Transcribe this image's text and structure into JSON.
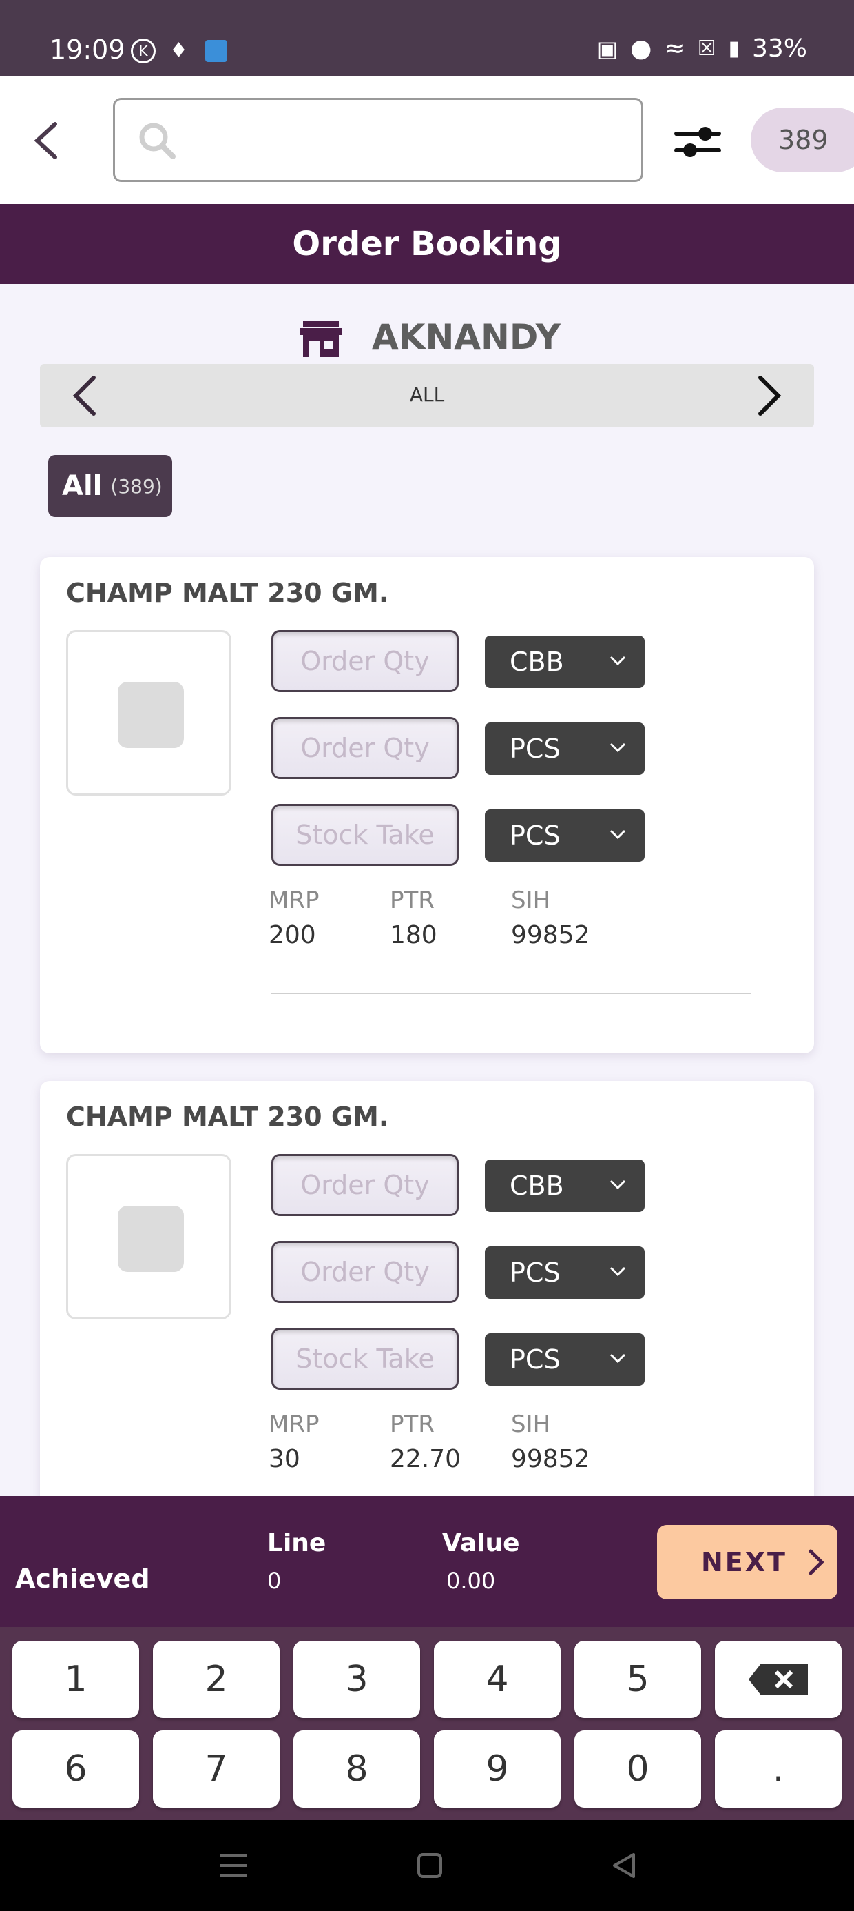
{
  "status_bar": {
    "time": "19:09",
    "k_badge": "K",
    "battery": "33%"
  },
  "search": {
    "placeholder": ""
  },
  "header": {
    "count": "389"
  },
  "title": "Order Booking",
  "store": {
    "name": "AKNANDY"
  },
  "category_nav": {
    "label": "ALL"
  },
  "filter_chip": {
    "label": "All",
    "count": "(389)"
  },
  "products": [
    {
      "name": "CHAMP MALT 230 GM.",
      "inputs": [
        {
          "placeholder": "Order Qty",
          "unit": "CBB"
        },
        {
          "placeholder": "Order Qty",
          "unit": "PCS"
        },
        {
          "placeholder": "Stock Take",
          "unit": "PCS"
        }
      ],
      "mrp_label": "MRP",
      "mrp": "200",
      "ptr_label": "PTR",
      "ptr": "180",
      "sih_label": "SIH",
      "sih": "99852"
    },
    {
      "name": "CHAMP MALT 230 GM.",
      "inputs": [
        {
          "placeholder": "Order Qty",
          "unit": "CBB"
        },
        {
          "placeholder": "Order Qty",
          "unit": "PCS"
        },
        {
          "placeholder": "Stock Take",
          "unit": "PCS"
        }
      ],
      "mrp_label": "MRP",
      "mrp": "30",
      "ptr_label": "PTR",
      "ptr": "22.70",
      "sih_label": "SIH",
      "sih": "99852"
    }
  ],
  "summary": {
    "achieved_label": "Achieved",
    "line_label": "Line",
    "line_value": "0",
    "value_label": "Value",
    "value_value": "0.00",
    "next_label": "NEXT"
  },
  "keypad": {
    "row1": [
      "1",
      "2",
      "3",
      "4",
      "5"
    ],
    "row2": [
      "6",
      "7",
      "8",
      "9",
      "0",
      "."
    ]
  },
  "colors": {
    "primary": "#4a1e48",
    "accent": "#fcc9a0",
    "status_bar": "#4b3a4d",
    "unit_select": "#414141"
  }
}
